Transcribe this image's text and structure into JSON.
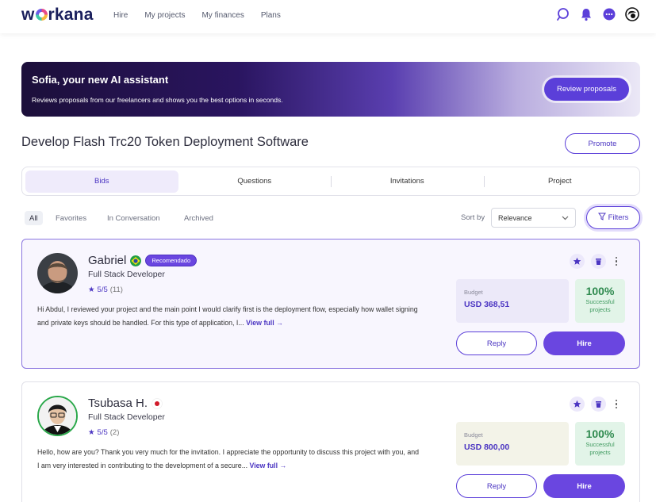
{
  "nav": {
    "logo": "workana",
    "links": [
      "Hire",
      "My projects",
      "My finances",
      "Plans"
    ],
    "icons": [
      "search-icon",
      "bell-icon",
      "chat-icon",
      "profile-avatar"
    ]
  },
  "banner": {
    "title": "Sofia, your new AI assistant",
    "subtitle": "Reviews proposals from our freelancers and shows you the best options in seconds.",
    "button": "Review proposals"
  },
  "project": {
    "title": "Develop Flash Trc20 Token Deployment Software",
    "promote": "Promote"
  },
  "tabs": [
    "Bids",
    "Questions",
    "Invitations",
    "Project"
  ],
  "filters": {
    "chips": [
      "All",
      "Favorites",
      "In Conversation",
      "Archived"
    ],
    "sort_label": "Sort by",
    "sort_value": "Relevance",
    "filters_button": "Filters"
  },
  "bids": [
    {
      "name": "Gabriel",
      "country_flag": "Brazil",
      "badge": "Recomendado",
      "role": "Full Stack Developer",
      "rating": "5/5",
      "reviews": "(11)",
      "proposal": "Hi Abdul, I reviewed your project and the main point I would clarify first is the deployment flow, especially how wallet signing and private keys should be handled. For this type of application, I...",
      "view_full": "View full →",
      "budget_label": "Budget",
      "budget_value": "USD 368,51",
      "success_pct": "100%",
      "success_label": "Successful projects",
      "reply": "Reply",
      "hire": "Hire"
    },
    {
      "name": "Tsubasa H.",
      "country_flag": "Japan",
      "badge": "",
      "role": "Full Stack Developer",
      "rating": "5/5",
      "reviews": "(2)",
      "proposal": "Hello, how are you? Thank you very much for the invitation. I appreciate the opportunity to discuss this project with you, and I am very interested in contributing to the development of a secure...",
      "view_full": "View full →",
      "budget_label": "Budget",
      "budget_value": "USD 800,00",
      "success_pct": "100%",
      "success_label": "Successful projects",
      "reply": "Reply",
      "hire": "Hire"
    }
  ],
  "colors": {
    "accent": "#5b3fd9",
    "success": "#2f8a4f",
    "brand_navy": "#1a1f5c"
  }
}
